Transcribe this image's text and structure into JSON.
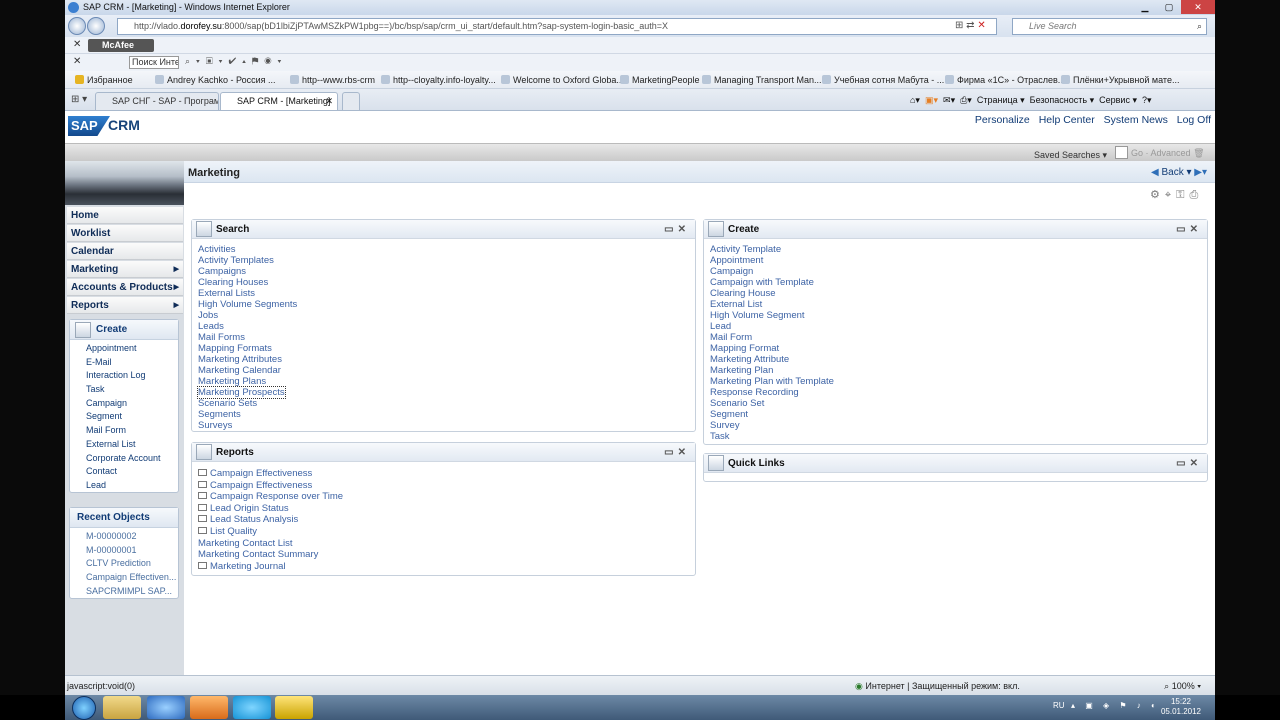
{
  "window": {
    "title": "SAP CRM - [Marketing] - Windows Internet Explorer"
  },
  "browser": {
    "url_prefix": "http://vlado.",
    "url_host": "dorofey.su",
    "url_rest": ":8000/sap(bD1lbiZjPTAwMSZkPW1pbg==)/bc/bsp/sap/crm_ui_start/default.htm?sap-system-login-basic_auth=X",
    "live_search_placeholder": "Live Search",
    "mcafee_label": "McAfee",
    "search_box_value": "Поиск Инте",
    "favorites_label": "Избранное",
    "favorites": [
      "Andrey Kachko - Россия ...",
      "http--www.rbs-crm",
      "http--cloyalty.info-loyalty...",
      "Welcome to Oxford Globa...",
      "MarketingPeople",
      "Managing Transport Man...",
      "Учебная сотня Мабута - ...",
      "Фирма «1С» - Отраслев...",
      "Плёнки+Укрывной мате..."
    ],
    "tabs": [
      {
        "label": "SAP СНГ - SAP - Програм..."
      },
      {
        "label": "SAP CRM - [Marketing]"
      }
    ],
    "commands": [
      "Страница ▾",
      "Безопасность ▾",
      "Сервис ▾"
    ],
    "status_left": "javascript:void(0)",
    "status_zone": "Интернет | Защищенный режим: вкл.",
    "zoom": "100%"
  },
  "sap": {
    "brand": "SAP",
    "product": "CRM",
    "top_links": [
      "Personalize",
      "Help Center",
      "System News",
      "Log Off"
    ],
    "saved_searches_label": "Saved Searches ▾",
    "go_label": "Go",
    "advanced_label": "Advanced",
    "page_title": "Marketing",
    "back_label": "Back ▾",
    "nav": [
      {
        "label": "Home",
        "submenu": false
      },
      {
        "label": "Worklist",
        "submenu": false
      },
      {
        "label": "Calendar",
        "submenu": false
      },
      {
        "label": "Marketing",
        "submenu": true
      },
      {
        "label": "Accounts & Products",
        "submenu": true
      },
      {
        "label": "Reports",
        "submenu": true
      }
    ],
    "create_panel": {
      "title": "Create",
      "items": [
        "Appointment",
        "E-Mail",
        "Interaction Log",
        "Task",
        "Campaign",
        "Segment",
        "Mail Form",
        "External List",
        "Corporate Account",
        "Contact",
        "Lead"
      ]
    },
    "recent_panel": {
      "title": "Recent Objects",
      "items": [
        "M-00000002",
        "M-00000001",
        "CLTV Prediction",
        "Campaign Effectiven...",
        "SAPCRMIMPL SAP..."
      ]
    },
    "search_block": {
      "title": "Search",
      "links": [
        "Activities",
        "Activity Templates",
        "Campaigns",
        "Clearing Houses",
        "External Lists",
        "High Volume Segments",
        "Jobs",
        "Leads",
        "Mail Forms",
        "Mapping Formats",
        "Marketing Attributes",
        "Marketing Calendar",
        "Marketing Plans",
        "Marketing Prospects",
        "Scenario Sets",
        "Segments",
        "Surveys"
      ]
    },
    "create_block": {
      "title": "Create",
      "links": [
        "Activity Template",
        "Appointment",
        "Campaign",
        "Campaign with Template",
        "Clearing House",
        "External List",
        "High Volume Segment",
        "Lead",
        "Mail Form",
        "Mapping Format",
        "Marketing Attribute",
        "Marketing Plan",
        "Marketing Plan with Template",
        "Response Recording",
        "Scenario Set",
        "Segment",
        "Survey",
        "Task"
      ]
    },
    "reports_block": {
      "title": "Reports",
      "links": [
        {
          "label": "Campaign Effectiveness",
          "icon": "envelope-icon"
        },
        {
          "label": "Campaign Effectiveness",
          "icon": "report-icon"
        },
        {
          "label": "Campaign Response over Time",
          "icon": "envelope-icon"
        },
        {
          "label": "Lead Origin Status",
          "icon": "report-icon"
        },
        {
          "label": "Lead Status Analysis",
          "icon": "report-icon"
        },
        {
          "label": "List Quality",
          "icon": "envelope-icon"
        },
        {
          "label": "Marketing Contact List",
          "icon": ""
        },
        {
          "label": "Marketing Contact Summary",
          "icon": ""
        },
        {
          "label": "Marketing Journal",
          "icon": "envelope-icon"
        }
      ]
    },
    "quick_links_block": {
      "title": "Quick Links"
    }
  },
  "taskbar": {
    "language": "RU",
    "time": "15:22",
    "date": "05.01.2012"
  }
}
